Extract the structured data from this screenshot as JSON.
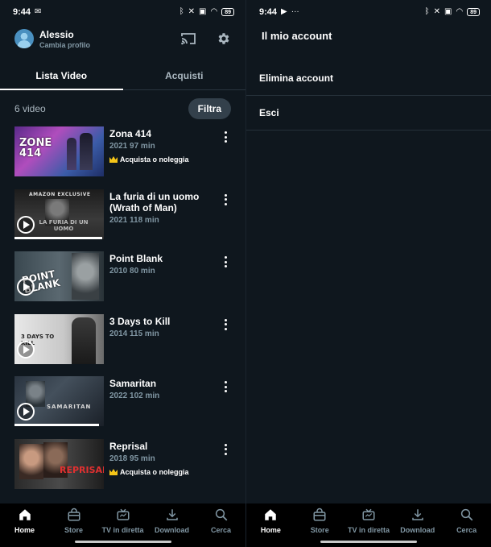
{
  "left": {
    "status": {
      "time": "9:44",
      "battery": "89"
    },
    "profile": {
      "name": "Alessio",
      "subtitle": "Cambia profilo"
    },
    "tabs": [
      {
        "label": "Lista Video",
        "active": true
      },
      {
        "label": "Acquisti",
        "active": false
      }
    ],
    "count_label": "6 video",
    "filter_label": "Filtra",
    "items": [
      {
        "title": "Zona 414",
        "meta": "2021 97 min",
        "buy": "Acquista o noleggia",
        "poster_text": "ZONE 414",
        "progress": 0
      },
      {
        "title": "La furia di un uomo (Wrath of Man)",
        "meta": "2021 118 min",
        "buy": "",
        "poster_text": "LA FURIA DI UN UOMO",
        "poster_top": "AMAZON EXCLUSIVE",
        "progress": 0.98
      },
      {
        "title": "Point Blank",
        "meta": "2010 80 min",
        "buy": "",
        "poster_text": "POINT BLANK",
        "progress": 0
      },
      {
        "title": "3 Days to Kill",
        "meta": "2014 115 min",
        "buy": "",
        "poster_text": "3 DAYS TO KILL",
        "progress": 0
      },
      {
        "title": "Samaritan",
        "meta": "2022 102 min",
        "buy": "",
        "poster_text": "SAMARITAN",
        "progress": 0.95
      },
      {
        "title": "Reprisal",
        "meta": "2018 95 min",
        "buy": "Acquista o noleggia",
        "poster_text": "REPRISAL",
        "progress": 0
      }
    ],
    "nav": [
      {
        "label": "Home",
        "icon": "home-icon",
        "active": true
      },
      {
        "label": "Store",
        "icon": "store-icon",
        "active": false
      },
      {
        "label": "TV in diretta",
        "icon": "live-tv-icon",
        "active": false
      },
      {
        "label": "Download",
        "icon": "download-icon",
        "active": false
      },
      {
        "label": "Cerca",
        "icon": "search-icon",
        "active": false
      }
    ]
  },
  "right": {
    "status": {
      "time": "9:44",
      "battery": "89"
    },
    "title": "Il mio account",
    "items": [
      {
        "label": "Elimina account"
      },
      {
        "label": "Esci"
      }
    ],
    "nav": [
      {
        "label": "Home",
        "icon": "home-icon",
        "active": true
      },
      {
        "label": "Store",
        "icon": "store-icon",
        "active": false
      },
      {
        "label": "TV in diretta",
        "icon": "live-tv-icon",
        "active": false
      },
      {
        "label": "Download",
        "icon": "download-icon",
        "active": false
      },
      {
        "label": "Cerca",
        "icon": "search-icon",
        "active": false
      }
    ]
  },
  "colors": {
    "background": "#0f171e",
    "nav_background": "#000000",
    "muted_text": "#8197a4",
    "filter_bg": "#33404b",
    "buy_icon": "#f5c518"
  }
}
